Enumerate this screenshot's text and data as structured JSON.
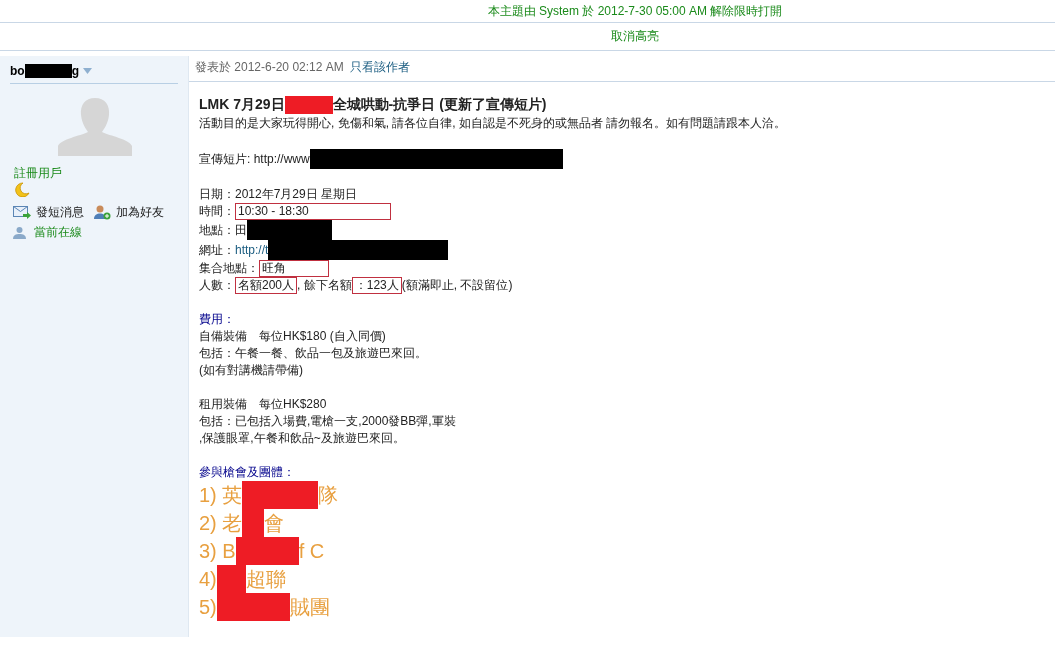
{
  "notices": [
    {
      "text": "本主題由 System 於 2012-7-30 05:00 AM 解除限時打開"
    },
    {
      "text": "取消高亮"
    }
  ],
  "author": {
    "name_start": "bo",
    "name_end": "g",
    "role": "註冊用戶",
    "actions": [
      {
        "kind": "message",
        "label": "發短消息"
      },
      {
        "kind": "friend",
        "label": "加為好友"
      }
    ],
    "status": "當前在線"
  },
  "post": {
    "posted": "發表於 2012-6-20 02:12 AM",
    "author_only": "只看該作者",
    "title": [
      {
        "kind": "text",
        "text": "LMK 7月29日"
      },
      {
        "kind": "redaction",
        "color": "#ee1c25"
      },
      {
        "kind": "text",
        "text": "全城哄動-抗爭日 (更新了宣傳短片)"
      }
    ],
    "paragraphs": [
      {
        "kind": "normal",
        "lines": [
          [
            {
              "kind": "text",
              "text": "活動目的是大家玩得開心, 免傷和氣, 請各位自律, 如自認是不死身的或無品者 請勿報名。如有問題請跟本人洽。"
            }
          ]
        ]
      },
      {
        "kind": "normal",
        "lines": [
          [
            {
              "kind": "text",
              "text": "宣傳短片: http://www"
            },
            {
              "kind": "redaction",
              "color": "#000000"
            }
          ]
        ]
      },
      {
        "kind": "normal",
        "lines": [
          [
            {
              "kind": "text",
              "text": "日期：2012年7月29日 星期日"
            }
          ],
          [
            {
              "kind": "text",
              "text": "時間："
            },
            {
              "kind": "boxed",
              "text": "10:30 - 18:30"
            }
          ],
          [
            {
              "kind": "text",
              "text": "地點：田"
            },
            {
              "kind": "redaction",
              "color": "#000000"
            }
          ],
          [
            {
              "kind": "text",
              "text": "網址："
            },
            {
              "kind": "link",
              "text": "http://t"
            },
            {
              "kind": "redaction",
              "color": "#000000"
            }
          ],
          [
            {
              "kind": "text",
              "text": "集合地點："
            },
            {
              "kind": "boxed",
              "text": "旺角"
            }
          ],
          [
            {
              "kind": "text",
              "text": "人數："
            },
            {
              "kind": "boxed",
              "text": "名額200人"
            },
            {
              "kind": "text",
              "text": ", 餘下名額"
            },
            {
              "kind": "boxed",
              "text": "：123人"
            },
            {
              "kind": "text",
              "text": "(額滿即止, 不設留位)"
            }
          ]
        ]
      },
      {
        "kind": "normal",
        "lines": [
          [
            {
              "kind": "heading",
              "text": "費用："
            }
          ],
          [
            {
              "kind": "text",
              "text": "自備裝備　每位HK$180 (自入同價)"
            }
          ],
          [
            {
              "kind": "text",
              "text": "包括：午餐一餐、飲品一包及旅遊巴來回。"
            }
          ],
          [
            {
              "kind": "text",
              "text": "(如有對講機請帶備)"
            }
          ]
        ]
      },
      {
        "kind": "normal",
        "lines": [
          [
            {
              "kind": "text",
              "text": "租用裝備　每位HK$280"
            }
          ],
          [
            {
              "kind": "text",
              "text": "包括：已包括入場費,電槍一支,2000發BB彈,軍裝"
            }
          ],
          [
            {
              "kind": "text",
              "text": ",保護眼罩,午餐和飲品~及旅遊巴來回。"
            }
          ]
        ]
      },
      {
        "kind": "spaced",
        "lines": [
          [
            {
              "kind": "heading",
              "text": "參與槍會及團體："
            }
          ],
          [
            {
              "kind": "big",
              "text": "1) 英"
            },
            {
              "kind": "redaction",
              "color": "#ee1c25"
            },
            {
              "kind": "big",
              "text": "隊"
            }
          ],
          [
            {
              "kind": "big",
              "text": "2) 老"
            },
            {
              "kind": "redaction",
              "color": "#ee1c25"
            },
            {
              "kind": "big",
              "text": "會"
            }
          ],
          [
            {
              "kind": "big",
              "text": "3) B"
            },
            {
              "kind": "redaction",
              "color": "#ee1c25"
            },
            {
              "kind": "big",
              "text": "f C"
            }
          ],
          [
            {
              "kind": "big",
              "text": "4) "
            },
            {
              "kind": "redaction",
              "color": "#ee1c25"
            },
            {
              "kind": "big",
              "text": "超聯"
            }
          ],
          [
            {
              "kind": "big",
              "text": "5) "
            },
            {
              "kind": "redaction",
              "color": "#ee1c25"
            },
            {
              "kind": "big",
              "text": "賊團"
            }
          ]
        ]
      }
    ]
  }
}
